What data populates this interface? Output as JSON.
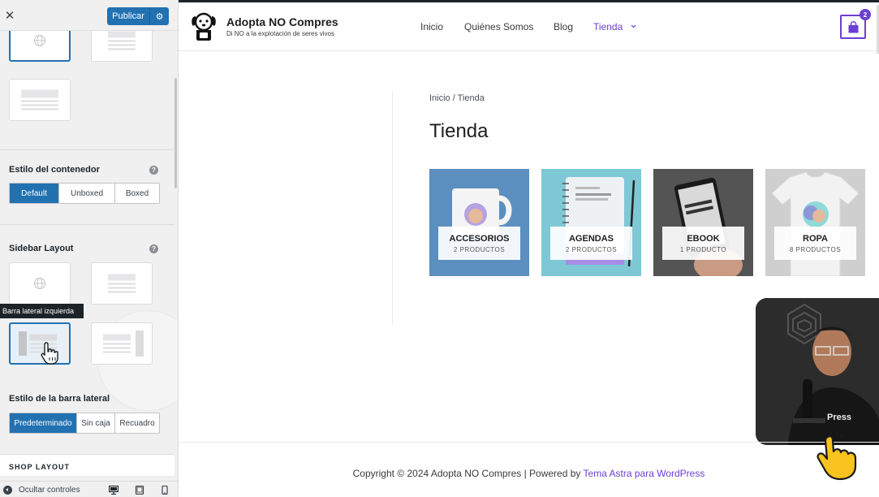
{
  "customizer": {
    "close_label": "✕",
    "publish_label": "Publicar",
    "container_style": {
      "title": "Estilo del contenedor",
      "options": [
        "Default",
        "Unboxed",
        "Boxed"
      ],
      "selected": "Default"
    },
    "sidebar_layout": {
      "title": "Sidebar Layout",
      "tooltip": "Barra lateral izquierda"
    },
    "sidebar_style": {
      "title": "Estilo de la barra lateral",
      "options": [
        "Predeterminado",
        "Sin caja",
        "Recuadro"
      ],
      "selected": "Predeterminado"
    },
    "shop_layout_title": "SHOP LAYOUT",
    "footer": {
      "hide_controls": "Ocultar controles"
    },
    "colors": {
      "accent": "#2271b1",
      "panel_bg": "#f0f0f1"
    }
  },
  "site": {
    "title": "Adopta NO Compres",
    "tagline": "Di NO a la explotación de seres vivos",
    "nav": [
      "Inicio",
      "Quiénes Somos",
      "Blog",
      "Tienda"
    ],
    "nav_active": "Tienda",
    "cart_count": "2",
    "breadcrumb": "Inicio / Tienda",
    "page_title": "Tienda",
    "categories": [
      {
        "name": "ACCESORIOS",
        "count": "2 PRODUCTOS",
        "bg": "#5b8fbf"
      },
      {
        "name": "AGENDAS",
        "count": "2 PRODUCTOS",
        "bg": "#7ec8d6"
      },
      {
        "name": "EBOOK",
        "count": "1 PRODUCTO",
        "bg": "#4a4a4a"
      },
      {
        "name": "ROPA",
        "count": "8 PRODUCTOS",
        "bg": "#cfcfcf"
      }
    ],
    "footer": {
      "copyright_text": "Copyright © 2024 Adopta NO Compres | Powered by ",
      "copyright_link": "Tema Astra para WordPress"
    },
    "colors": {
      "accent": "#6a3fd4"
    }
  }
}
